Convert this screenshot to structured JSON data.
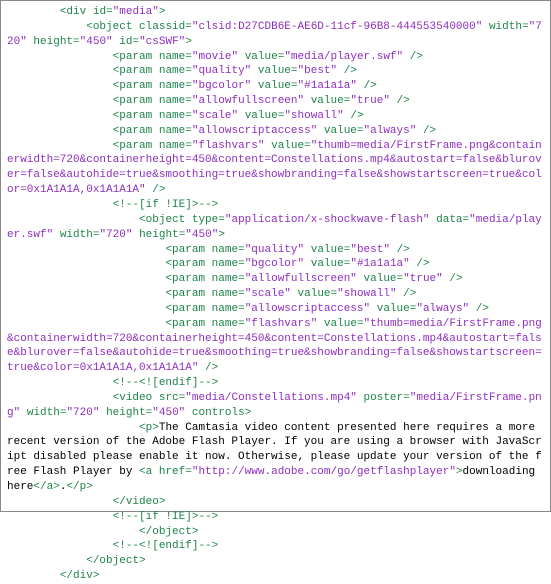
{
  "lines": [
    "        <div id=\"media\">",
    "            <object classid=\"clsid:D27CDB6E-AE6D-11cf-96B8-444553540000\" width=\"720\" height=\"450\" id=\"csSWF\">",
    "                <param name=\"movie\" value=\"media/player.swf\" />",
    "                <param name=\"quality\" value=\"best\" />",
    "                <param name=\"bgcolor\" value=\"#1a1a1a\" />",
    "                <param name=\"allowfullscreen\" value=\"true\" />",
    "                <param name=\"scale\" value=\"showall\" />",
    "                <param name=\"allowscriptaccess\" value=\"always\" />",
    "                <param name=\"flashvars\" value=\"thumb=media/FirstFrame.png&containerwidth=720&containerheight=450&content=Constellations.mp4&autostart=false&blurover=false&autohide=true&smoothing=true&showbranding=false&showstartscreen=true&color=0x1A1A1A,0x1A1A1A\" />",
    "                <!--[if !IE]>-->",
    "                    <object type=\"application/x-shockwave-flash\" data=\"media/player.swf\" width=\"720\" height=\"450\">",
    "                        <param name=\"quality\" value=\"best\" />",
    "                        <param name=\"bgcolor\" value=\"#1a1a1a\" />",
    "                        <param name=\"allowfullscreen\" value=\"true\" />",
    "                        <param name=\"scale\" value=\"showall\" />",
    "                        <param name=\"allowscriptaccess\" value=\"always\" />",
    "                        <param name=\"flashvars\" value=\"thumb=media/FirstFrame.png&containerwidth=720&containerheight=450&content=Constellations.mp4&autostart=false&blurover=false&autohide=true&smoothing=true&showbranding=false&showstartscreen=true&color=0x1A1A1A,0x1A1A1A\" />",
    "                <!--<![endif]-->",
    "                <video src=\"media/Constellations.mp4\" poster=\"media/FirstFrame.png\" width=\"720\" height=\"450\" controls>",
    "                    <p>The Camtasia video content presented here requires a more recent version of the Adobe Flash Player. If you are using a browser with JavaScript disabled please enable it now. Otherwise, please update your version of the free Flash Player by <a href=\"http://www.adobe.com/go/getflashplayer\">downloading here</a>.</p>",
    "                </video>",
    "                <!--[if !IE]>-->",
    "                    </object>",
    "                <!--<![endif]-->",
    "            </object>",
    "        </div>"
  ]
}
